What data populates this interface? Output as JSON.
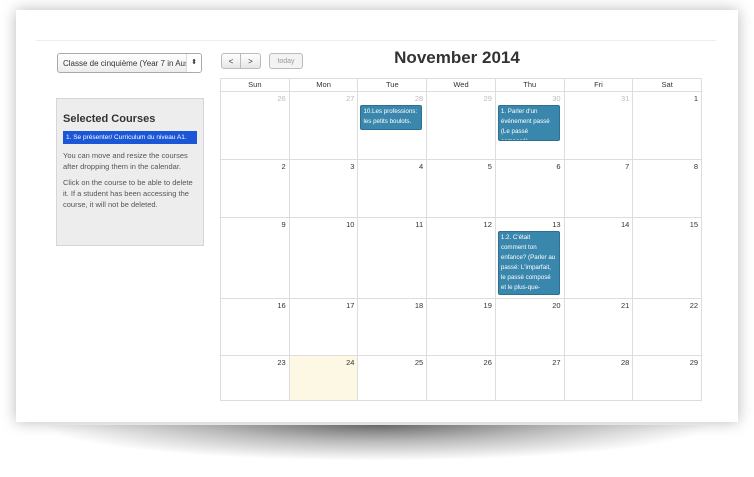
{
  "course_select": {
    "value": "Classe de cinquième (Year 7 in Aus",
    "caret": "⬍"
  },
  "sidebar": {
    "title": "Selected Courses",
    "selected_item": "1. Se présenter/ Curriculum du niveau A1.",
    "help1": "You can move and resize the courses after dropping them in the calendar.",
    "help2": "Click on the course to be able to delete it. If a student has been accessing the course, it will not be deleted."
  },
  "toolbar": {
    "prev": "<",
    "next": ">",
    "today": "today"
  },
  "calendar": {
    "title": "November 2014",
    "weekdays": [
      "Sun",
      "Mon",
      "Tue",
      "Wed",
      "Thu",
      "Fri",
      "Sat"
    ],
    "weeks": [
      [
        "26",
        "27",
        "28",
        "29",
        "30",
        "31",
        "1"
      ],
      [
        "2",
        "3",
        "4",
        "5",
        "6",
        "7",
        "8"
      ],
      [
        "9",
        "10",
        "11",
        "12",
        "13",
        "14",
        "15"
      ],
      [
        "16",
        "17",
        "18",
        "19",
        "20",
        "21",
        "22"
      ],
      [
        "23",
        "24",
        "25",
        "26",
        "27",
        "28",
        "29"
      ]
    ],
    "events": {
      "tue_28": "10.Les professions: les petits boulots.",
      "thu_30": "1. Parler d'un événement passé (Le passé composé).",
      "thu_13": "1.2. C'était comment ton enfance? (Parler au passé: L'imparfait, le passé composé et le plus-que-parfait)."
    }
  },
  "colors": {
    "event": "#3a87ad",
    "selected_course": "#1a56d6",
    "today": "#fcf8e3"
  }
}
